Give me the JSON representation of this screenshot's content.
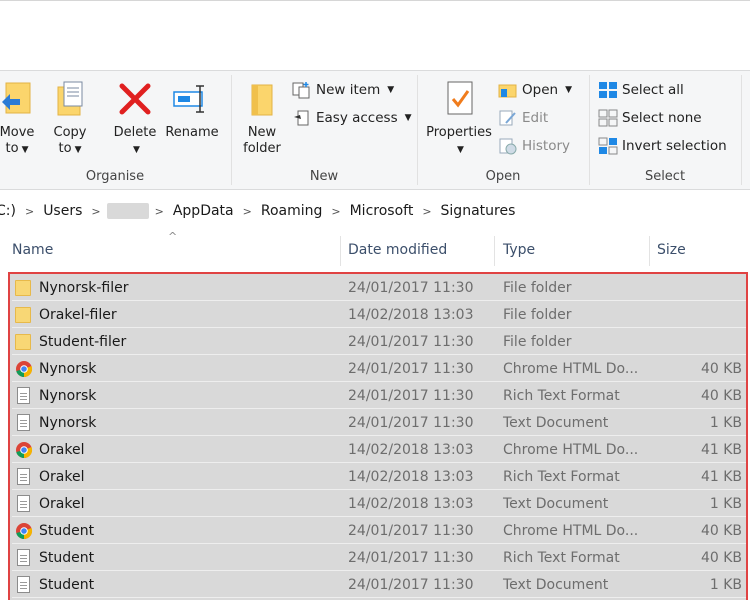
{
  "ribbon": {
    "organise": {
      "label": "Organise",
      "move_to": {
        "line1": "Move",
        "line2": "to"
      },
      "copy_to": {
        "line1": "Copy",
        "line2": "to"
      },
      "delete": "Delete",
      "rename": "Rename"
    },
    "new": {
      "label": "New",
      "new_folder": {
        "line1": "New",
        "line2": "folder"
      },
      "new_item": "New item",
      "easy_access": "Easy access"
    },
    "open": {
      "label": "Open",
      "properties": "Properties",
      "open_btn": "Open",
      "edit": "Edit",
      "history": "History"
    },
    "select": {
      "label": "Select",
      "select_all": "Select all",
      "select_none": "Select none",
      "invert_selection": "Invert selection"
    }
  },
  "address": {
    "crumbs": [
      "C:)",
      "Users",
      "AppData",
      "Roaming",
      "Microsoft",
      "Signatures"
    ]
  },
  "columns": {
    "name": "Name",
    "date": "Date modified",
    "type": "Type",
    "size": "Size"
  },
  "files": [
    {
      "name": "Nynorsk-filer",
      "date": "24/01/2017 11:30",
      "type": "File folder",
      "size": "",
      "icon": "folder-icon"
    },
    {
      "name": "Orakel-filer",
      "date": "14/02/2018 13:03",
      "type": "File folder",
      "size": "",
      "icon": "folder-icon"
    },
    {
      "name": "Student-filer",
      "date": "24/01/2017 11:30",
      "type": "File folder",
      "size": "",
      "icon": "folder-icon"
    },
    {
      "name": "Nynorsk",
      "date": "24/01/2017 11:30",
      "type": "Chrome HTML Do...",
      "size": "40 KB",
      "icon": "chrome-icon"
    },
    {
      "name": "Nynorsk",
      "date": "24/01/2017 11:30",
      "type": "Rich Text Format",
      "size": "40 KB",
      "icon": "document-icon"
    },
    {
      "name": "Nynorsk",
      "date": "24/01/2017 11:30",
      "type": "Text Document",
      "size": "1 KB",
      "icon": "document-icon"
    },
    {
      "name": "Orakel",
      "date": "14/02/2018 13:03",
      "type": "Chrome HTML Do...",
      "size": "41 KB",
      "icon": "chrome-icon"
    },
    {
      "name": "Orakel",
      "date": "14/02/2018 13:03",
      "type": "Rich Text Format",
      "size": "41 KB",
      "icon": "document-icon"
    },
    {
      "name": "Orakel",
      "date": "14/02/2018 13:03",
      "type": "Text Document",
      "size": "1 KB",
      "icon": "document-icon"
    },
    {
      "name": "Student",
      "date": "24/01/2017 11:30",
      "type": "Chrome HTML Do...",
      "size": "40 KB",
      "icon": "chrome-icon"
    },
    {
      "name": "Student",
      "date": "24/01/2017 11:30",
      "type": "Rich Text Format",
      "size": "40 KB",
      "icon": "document-icon"
    },
    {
      "name": "Student",
      "date": "24/01/2017 11:30",
      "type": "Text Document",
      "size": "1 KB",
      "icon": "document-icon"
    }
  ],
  "colors": {
    "selection_border": "#e04343",
    "row_selected": "#d9d9d9",
    "accent_blue": "#1e88e5"
  }
}
